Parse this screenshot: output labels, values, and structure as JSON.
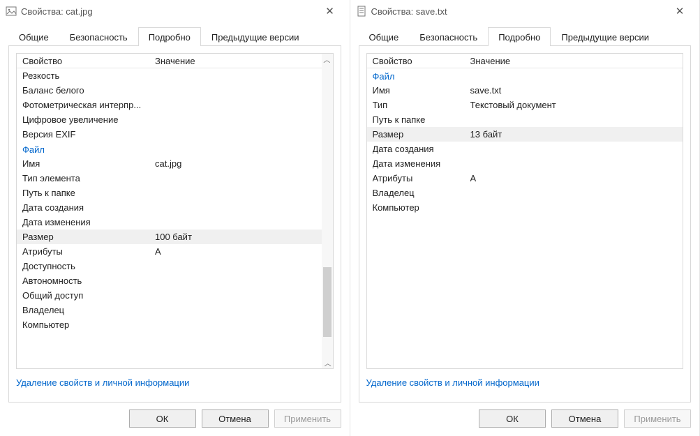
{
  "left": {
    "title": "Свойства: cat.jpg",
    "tabs": {
      "general": "Общие",
      "security": "Безопасность",
      "details": "Подробно",
      "previous": "Предыдущие версии"
    },
    "header": {
      "prop": "Свойство",
      "val": "Значение"
    },
    "rows_top": [
      {
        "prop": "Резкость",
        "val": ""
      },
      {
        "prop": "Баланс белого",
        "val": ""
      },
      {
        "prop": "Фотометрическая интерпр...",
        "val": ""
      },
      {
        "prop": "Цифровое увеличение",
        "val": ""
      },
      {
        "prop": "Версия EXIF",
        "val": ""
      }
    ],
    "section": "Файл",
    "rows_file": [
      {
        "prop": "Имя",
        "val": "cat.jpg"
      },
      {
        "prop": "Тип элемента",
        "val": ""
      },
      {
        "prop": "Путь к папке",
        "val": ""
      },
      {
        "prop": "Дата создания",
        "val": ""
      },
      {
        "prop": "Дата изменения",
        "val": ""
      },
      {
        "prop": "Размер",
        "val": "100 байт",
        "hl": true
      },
      {
        "prop": "Атрибуты",
        "val": "A"
      },
      {
        "prop": "Доступность",
        "val": ""
      },
      {
        "prop": "Автономность",
        "val": ""
      },
      {
        "prop": "Общий доступ",
        "val": ""
      },
      {
        "prop": "Владелец",
        "val": ""
      },
      {
        "prop": "Компьютер",
        "val": ""
      }
    ],
    "link": "Удаление свойств и личной информации",
    "buttons": {
      "ok": "ОК",
      "cancel": "Отмена",
      "apply": "Применить"
    }
  },
  "right": {
    "title": "Свойства: save.txt",
    "tabs": {
      "general": "Общие",
      "security": "Безопасность",
      "details": "Подробно",
      "previous": "Предыдущие версии"
    },
    "header": {
      "prop": "Свойство",
      "val": "Значение"
    },
    "section": "Файл",
    "rows_file": [
      {
        "prop": "Имя",
        "val": "save.txt"
      },
      {
        "prop": "Тип",
        "val": "Текстовый документ"
      },
      {
        "prop": "Путь к папке",
        "val": ""
      },
      {
        "prop": "Размер",
        "val": "13 байт",
        "hl": true
      },
      {
        "prop": "Дата создания",
        "val": ""
      },
      {
        "prop": "Дата изменения",
        "val": ""
      },
      {
        "prop": "Атрибуты",
        "val": "A"
      },
      {
        "prop": "Владелец",
        "val": ""
      },
      {
        "prop": "Компьютер",
        "val": ""
      }
    ],
    "link": "Удаление свойств и личной информации",
    "buttons": {
      "ok": "ОК",
      "cancel": "Отмена",
      "apply": "Применить"
    }
  }
}
